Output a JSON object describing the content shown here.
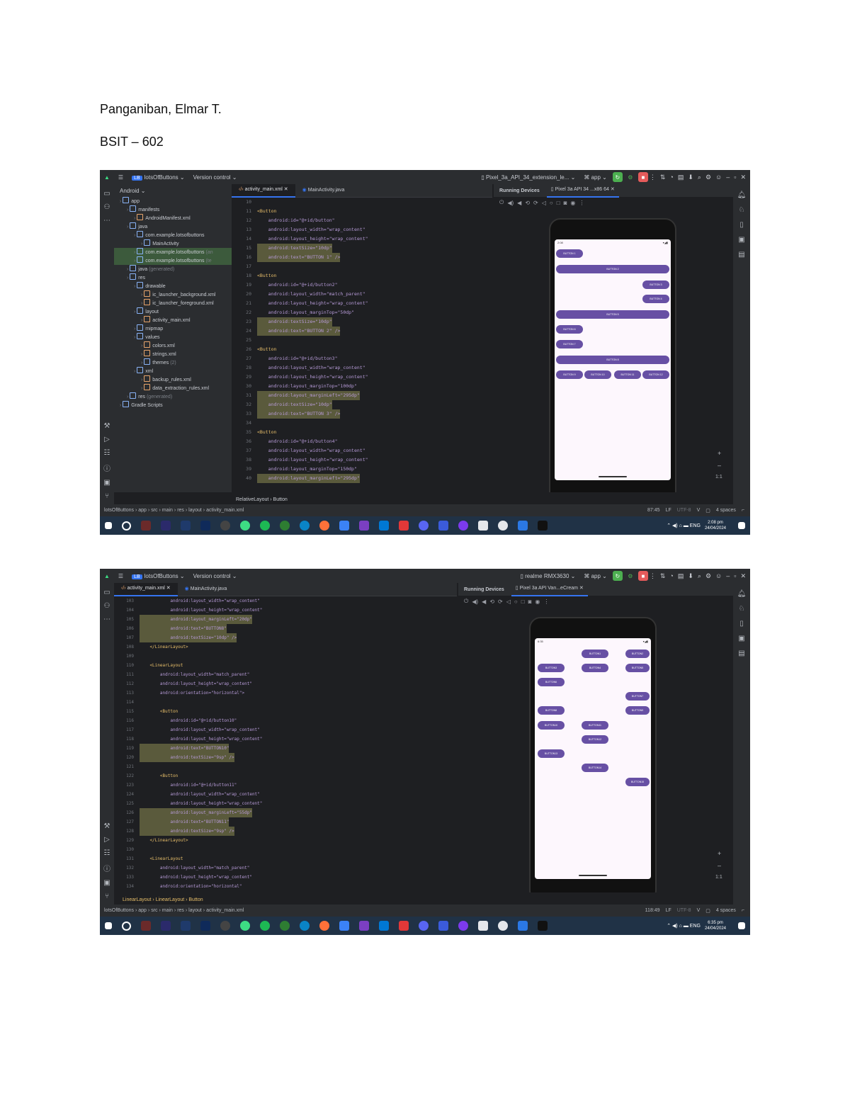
{
  "document": {
    "name_line": "Panganiban, Elmar T.",
    "section_line": "BSIT – 602"
  },
  "screenshot1": {
    "titlebar": {
      "project": "lotsOfButtons",
      "project_badge": "LB",
      "version_control": "Version control",
      "device": "Pixel_3a_API_34_extension_le...",
      "run_config": "app"
    },
    "project_panel": {
      "header": "Android",
      "items": [
        {
          "label": "app",
          "depth": 0
        },
        {
          "label": "manifests",
          "depth": 1
        },
        {
          "label": "AndroidManifest.xml",
          "depth": 2
        },
        {
          "label": "java",
          "depth": 1
        },
        {
          "label": "com.example.lotsofbuttons",
          "depth": 2
        },
        {
          "label": "MainActivity",
          "depth": 3
        },
        {
          "label": "com.example.lotsofbuttons",
          "suffix": "(an",
          "depth": 2,
          "hl": true
        },
        {
          "label": "com.example.lotsofbuttons",
          "suffix": "(te",
          "depth": 2,
          "hl": true
        },
        {
          "label": "java",
          "suffix": "(generated)",
          "depth": 1
        },
        {
          "label": "res",
          "depth": 1
        },
        {
          "label": "drawable",
          "depth": 2
        },
        {
          "label": "ic_launcher_background.xml",
          "depth": 3
        },
        {
          "label": "ic_launcher_foreground.xml",
          "depth": 3
        },
        {
          "label": "layout",
          "depth": 2
        },
        {
          "label": "activity_main.xml",
          "depth": 3
        },
        {
          "label": "mipmap",
          "depth": 2
        },
        {
          "label": "values",
          "depth": 2
        },
        {
          "label": "colors.xml",
          "depth": 3
        },
        {
          "label": "strings.xml",
          "depth": 3
        },
        {
          "label": "themes",
          "suffix": "(2)",
          "depth": 3
        },
        {
          "label": "xml",
          "depth": 2
        },
        {
          "label": "backup_rules.xml",
          "depth": 3
        },
        {
          "label": "data_extraction_rules.xml",
          "depth": 3
        },
        {
          "label": "res",
          "suffix": "(generated)",
          "depth": 1
        },
        {
          "label": "Gradle Scripts",
          "depth": 0
        }
      ]
    },
    "tabs": [
      "activity_main.xml",
      "MainActivity.java"
    ],
    "code": [
      {
        "n": "10",
        "t": ""
      },
      {
        "n": "11",
        "t": "<Button"
      },
      {
        "n": "12",
        "t": "    android:id=\"@+id/button\""
      },
      {
        "n": "13",
        "t": "    android:layout_width=\"wrap_content\""
      },
      {
        "n": "14",
        "t": "    android:layout_height=\"wrap_content\""
      },
      {
        "n": "15",
        "t": "    android:textSize=\"10dp\""
      },
      {
        "n": "16",
        "t": "    android:text=\"BUTTON 1\" />"
      },
      {
        "n": "17",
        "t": ""
      },
      {
        "n": "18",
        "t": "<Button"
      },
      {
        "n": "19",
        "t": "    android:id=\"@+id/button2\""
      },
      {
        "n": "20",
        "t": "    android:layout_width=\"match_parent\""
      },
      {
        "n": "21",
        "t": "    android:layout_height=\"wrap_content\""
      },
      {
        "n": "22",
        "t": "    android:layout_marginTop=\"50dp\""
      },
      {
        "n": "23",
        "t": "    android:textSize=\"10dp\""
      },
      {
        "n": "24",
        "t": "    android:text=\"BUTTON 2\" />"
      },
      {
        "n": "25",
        "t": ""
      },
      {
        "n": "26",
        "t": "<Button"
      },
      {
        "n": "27",
        "t": "    android:id=\"@+id/button3\""
      },
      {
        "n": "28",
        "t": "    android:layout_width=\"wrap_content\""
      },
      {
        "n": "29",
        "t": "    android:layout_height=\"wrap_content\""
      },
      {
        "n": "30",
        "t": "    android:layout_marginTop=\"100dp\""
      },
      {
        "n": "31",
        "t": "    android:layout_marginLeft=\"295dp\""
      },
      {
        "n": "32",
        "t": "    android:textSize=\"10dp\""
      },
      {
        "n": "33",
        "t": "    android:text=\"BUTTON 3\" />"
      },
      {
        "n": "34",
        "t": ""
      },
      {
        "n": "35",
        "t": "<Button"
      },
      {
        "n": "36",
        "t": "    android:id=\"@+id/button4\""
      },
      {
        "n": "37",
        "t": "    android:layout_width=\"wrap_content\""
      },
      {
        "n": "38",
        "t": "    android:layout_height=\"wrap_content\""
      },
      {
        "n": "39",
        "t": "    android:layout_marginTop=\"150dp\""
      },
      {
        "n": "40",
        "t": "    android:layout_marginLeft=\"295dp\""
      }
    ],
    "editor_breadcrumb": "RelativeLayout  ›  Button",
    "running_devices": {
      "title": "Running Devices",
      "device_tab": "Pixel 3a API 34 ...x86 64",
      "time": "2:08",
      "buttons": [
        "BUTTON 1",
        "BUTTON 2",
        "BUTTON 3",
        "BUTTON 4",
        "BUTTON 5",
        "BUTTON 6",
        "BUTTON 7",
        "BUTTON 8",
        "BUTTON 9",
        "BUTTON 10",
        "BUTTON 11",
        "BUTTON 12"
      ],
      "zoom": "1:1"
    },
    "statusbar": {
      "path": [
        "lotsOfButtons",
        "app",
        "src",
        "main",
        "res",
        "layout",
        "activity_main.xml"
      ],
      "position": "87:45",
      "line_sep": "LF",
      "encoding": "UTF-8",
      "indent": "4 spaces"
    },
    "taskbar": {
      "lang": "ENG",
      "time": "2:08 pm",
      "date": "24/04/2024"
    }
  },
  "screenshot2": {
    "titlebar": {
      "project": "lotsOfButtons",
      "project_badge": "LB",
      "version_control": "Version control",
      "device": "realme RMX3630",
      "run_config": "app"
    },
    "tabs": [
      "activity_main.xml",
      "MainActivity.java"
    ],
    "code": [
      {
        "n": "103",
        "t": "            android:layout_width=\"wrap_content\""
      },
      {
        "n": "104",
        "t": "            android:layout_height=\"wrap_content\""
      },
      {
        "n": "105",
        "t": "            android:layout_marginLeft=\"20dp\""
      },
      {
        "n": "106",
        "t": "            android:text=\"BUTTON8\""
      },
      {
        "n": "107",
        "t": "            android:textSize=\"10dp\" />"
      },
      {
        "n": "108",
        "t": "    </LinearLayout>"
      },
      {
        "n": "109",
        "t": ""
      },
      {
        "n": "110",
        "t": "    <LinearLayout"
      },
      {
        "n": "111",
        "t": "        android:layout_width=\"match_parent\""
      },
      {
        "n": "112",
        "t": "        android:layout_height=\"wrap_content\""
      },
      {
        "n": "113",
        "t": "        android:orientation=\"horizontal\">"
      },
      {
        "n": "114",
        "t": ""
      },
      {
        "n": "115",
        "t": "        <Button"
      },
      {
        "n": "116",
        "t": "            android:id=\"@+id/button10\""
      },
      {
        "n": "117",
        "t": "            android:layout_width=\"wrap_content\""
      },
      {
        "n": "118",
        "t": "            android:layout_height=\"wrap_content\""
      },
      {
        "n": "119",
        "t": "            android:text=\"BUTTON10\""
      },
      {
        "n": "120",
        "t": "            android:textSize=\"9sp\" />"
      },
      {
        "n": "121",
        "t": ""
      },
      {
        "n": "122",
        "t": "        <Button"
      },
      {
        "n": "123",
        "t": "            android:id=\"@+id/button11\""
      },
      {
        "n": "124",
        "t": "            android:layout_width=\"wrap_content\""
      },
      {
        "n": "125",
        "t": "            android:layout_height=\"wrap_content\""
      },
      {
        "n": "126",
        "t": "            android:layout_marginLeft=\"55dp\""
      },
      {
        "n": "127",
        "t": "            android:text=\"BUTTON11\""
      },
      {
        "n": "128",
        "t": "            android:textSize=\"9sp\" />"
      },
      {
        "n": "129",
        "t": "    </LinearLayout>"
      },
      {
        "n": "130",
        "t": ""
      },
      {
        "n": "131",
        "t": "    <LinearLayout"
      },
      {
        "n": "132",
        "t": "        android:layout_width=\"match_parent\""
      },
      {
        "n": "133",
        "t": "        android:layout_height=\"wrap_content\""
      },
      {
        "n": "134",
        "t": "        android:orientation=\"horizontal\""
      },
      {
        "n": "135",
        "t": "        android:gravity=\"center\">"
      }
    ],
    "editor_breadcrumb": "LinearLayout  ›  LinearLayout  ›  Button",
    "running_devices": {
      "title": "Running Devices",
      "device_tab": "Pixel 3a API Van...eCream",
      "time": "6:35",
      "buttons": [
        "BUTTON1",
        "BUTTON2",
        "BUTTON3",
        "BUTTON4",
        "BUTTON5",
        "BUTTON6",
        "BUTTON7",
        "BUTTON8",
        "BUTTON9",
        "BUTTON10",
        "BUTTON11",
        "BUTTON12",
        "BUTTON13",
        "BUTTON14",
        "BUTTON15"
      ],
      "zoom": "1:1"
    },
    "statusbar": {
      "path": [
        "lotsOfButtons",
        "app",
        "src",
        "main",
        "res",
        "layout",
        "activity_main.xml"
      ],
      "position": "118:49",
      "line_sep": "LF",
      "encoding": "UTF-8",
      "indent": "4 spaces"
    },
    "taskbar": {
      "lang": "ENG",
      "time": "6:35 pm",
      "date": "24/04/2024"
    }
  },
  "colors": {
    "ide_bg": "#1e1f22",
    "panel_bg": "#2b2d30",
    "accent": "#3574f0",
    "button_purple": "#6750a4",
    "run_green": "#4caf50",
    "stop_red": "#e55b5b",
    "taskbar": "#203246"
  }
}
